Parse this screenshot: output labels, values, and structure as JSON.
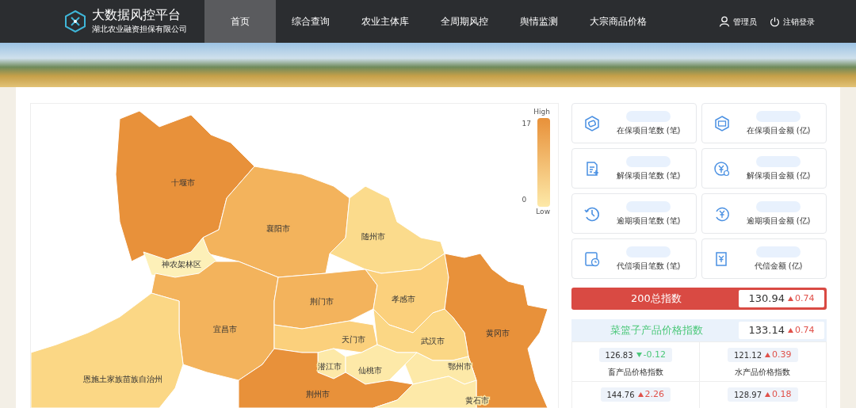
{
  "header": {
    "title": "大数据风控平台",
    "subtitle": "湖北农业融资担保有限公司",
    "nav": [
      {
        "label": "首页",
        "selected": true
      },
      {
        "label": "综合查询",
        "selected": false
      },
      {
        "label": "农业主体库",
        "selected": false
      },
      {
        "label": "全周期风控",
        "selected": false
      },
      {
        "label": "舆情监测",
        "selected": false
      },
      {
        "label": "大宗商品价格",
        "selected": false
      }
    ],
    "user": "管理员",
    "logout": "注销登录"
  },
  "map": {
    "legend": {
      "high": "High",
      "max": "17",
      "min": "0",
      "low": "Low"
    },
    "regions": [
      {
        "name": "十堰市",
        "color": "#e8913a"
      },
      {
        "name": "襄阳市",
        "color": "#f3b35c"
      },
      {
        "name": "随州市",
        "color": "#fbdb8c"
      },
      {
        "name": "神农架林区",
        "color": "#fdf0b8"
      },
      {
        "name": "宜昌市",
        "color": "#f3b35c"
      },
      {
        "name": "荆门市",
        "color": "#f3b35c"
      },
      {
        "name": "孝感市",
        "color": "#fbd07c"
      },
      {
        "name": "黄冈市",
        "color": "#e8913a"
      },
      {
        "name": "恩施土家族苗族自治州",
        "color": "#fbd785"
      },
      {
        "name": "天门市",
        "color": "#fbd07c"
      },
      {
        "name": "武汉市",
        "color": "#fbd785"
      },
      {
        "name": "潜江市",
        "color": "#fde9a8"
      },
      {
        "name": "仙桃市",
        "color": "#fde9a8"
      },
      {
        "name": "鄂州市",
        "color": "#fde9a8"
      },
      {
        "name": "荆州市",
        "color": "#e8913a"
      },
      {
        "name": "黄石市",
        "color": "#fde9a8"
      }
    ]
  },
  "stats": [
    {
      "kind": "shield",
      "label": "在保项目笔数 (笔)"
    },
    {
      "kind": "ticket",
      "label": "在保项目金额 (亿)"
    },
    {
      "kind": "doc",
      "label": "解保项目笔数 (笔)"
    },
    {
      "kind": "yen",
      "label": "解保项目金额 (亿)"
    },
    {
      "kind": "clock",
      "label": "逾期项目笔数 (笔)"
    },
    {
      "kind": "yenback",
      "label": "逾期项目金额 (亿)"
    },
    {
      "kind": "calendar",
      "label": "代偿项目笔数 (笔)"
    },
    {
      "kind": "yendoc",
      "label": "代偿金额 (亿)"
    }
  ],
  "total_index": {
    "label": "200总指数",
    "value": "130.94",
    "change": "0.74",
    "rising": true
  },
  "basket": {
    "title": "菜篮子产品价格指数",
    "value": "133.14",
    "change": "0.74",
    "rising": true,
    "items": [
      {
        "value": "126.83",
        "change": "-0.12",
        "rising": false,
        "label": "畜产品价格指数"
      },
      {
        "value": "121.12",
        "change": "0.39",
        "rising": true,
        "label": "水产品价格指数"
      },
      {
        "value": "144.76",
        "change": "2.26",
        "rising": true
      },
      {
        "value": "128.97",
        "change": "0.18",
        "rising": true
      }
    ]
  }
}
